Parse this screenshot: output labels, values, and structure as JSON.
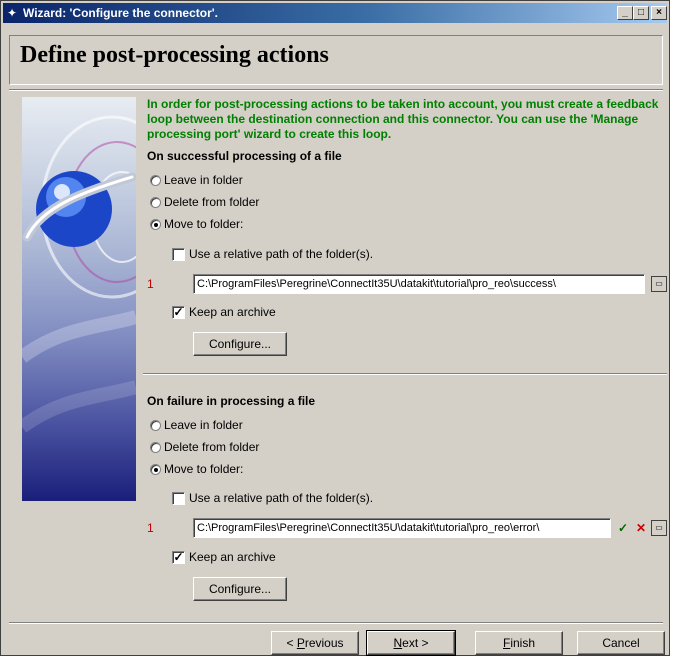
{
  "window": {
    "title": "Wizard: 'Configure the connector'.",
    "controls": {
      "minimize": "_",
      "maximize": "□",
      "close": "×"
    }
  },
  "page": {
    "heading": "Define post-processing actions",
    "intro": "In order for post-processing actions to be taken into account, you must create a feedback loop between the destination connection and this connector. You can use the 'Manage processing port' wizard to create this loop."
  },
  "success": {
    "title": "On successful processing of a file",
    "options": [
      "Leave in folder",
      "Delete from folder",
      "Move to folder:"
    ],
    "selected": "Move to folder:",
    "relative_path_label": "Use a relative path of the folder(s).",
    "relative_path_checked": false,
    "row_index": "1",
    "path": "C:\\ProgramFiles\\Peregrine\\ConnectIt35U\\datakit\\tutorial\\pro_reo\\success\\",
    "keep_archive_label": "Keep an archive",
    "keep_archive_checked": true,
    "configure_label": "Configure..."
  },
  "failure": {
    "title": "On failure in processing a file",
    "options": [
      "Leave in folder",
      "Delete from folder",
      "Move to folder:"
    ],
    "selected": "Move to folder:",
    "relative_path_label": "Use a relative path of the folder(s).",
    "relative_path_checked": false,
    "row_index": "1",
    "path": "C:\\ProgramFiles\\Peregrine\\ConnectIt35U\\datakit\\tutorial\\pro_reo\\error\\",
    "keep_archive_label": "Keep an archive",
    "keep_archive_checked": true,
    "configure_label": "Configure..."
  },
  "footer": {
    "previous": {
      "prefix": "< ",
      "accel": "P",
      "rest": "revious"
    },
    "next": {
      "accel": "N",
      "rest": "ext >"
    },
    "finish": {
      "accel": "F",
      "rest": "inish"
    },
    "cancel": "Cancel"
  },
  "icons": {
    "app": "wizard-icon",
    "browse": "browse-icon",
    "validate": "checkmark-icon",
    "clear": "cross-icon"
  },
  "colors": {
    "titlebar_start": "#0a246a",
    "titlebar_end": "#a6caf0",
    "intro_text": "#008000",
    "row_index": "#c00000"
  }
}
